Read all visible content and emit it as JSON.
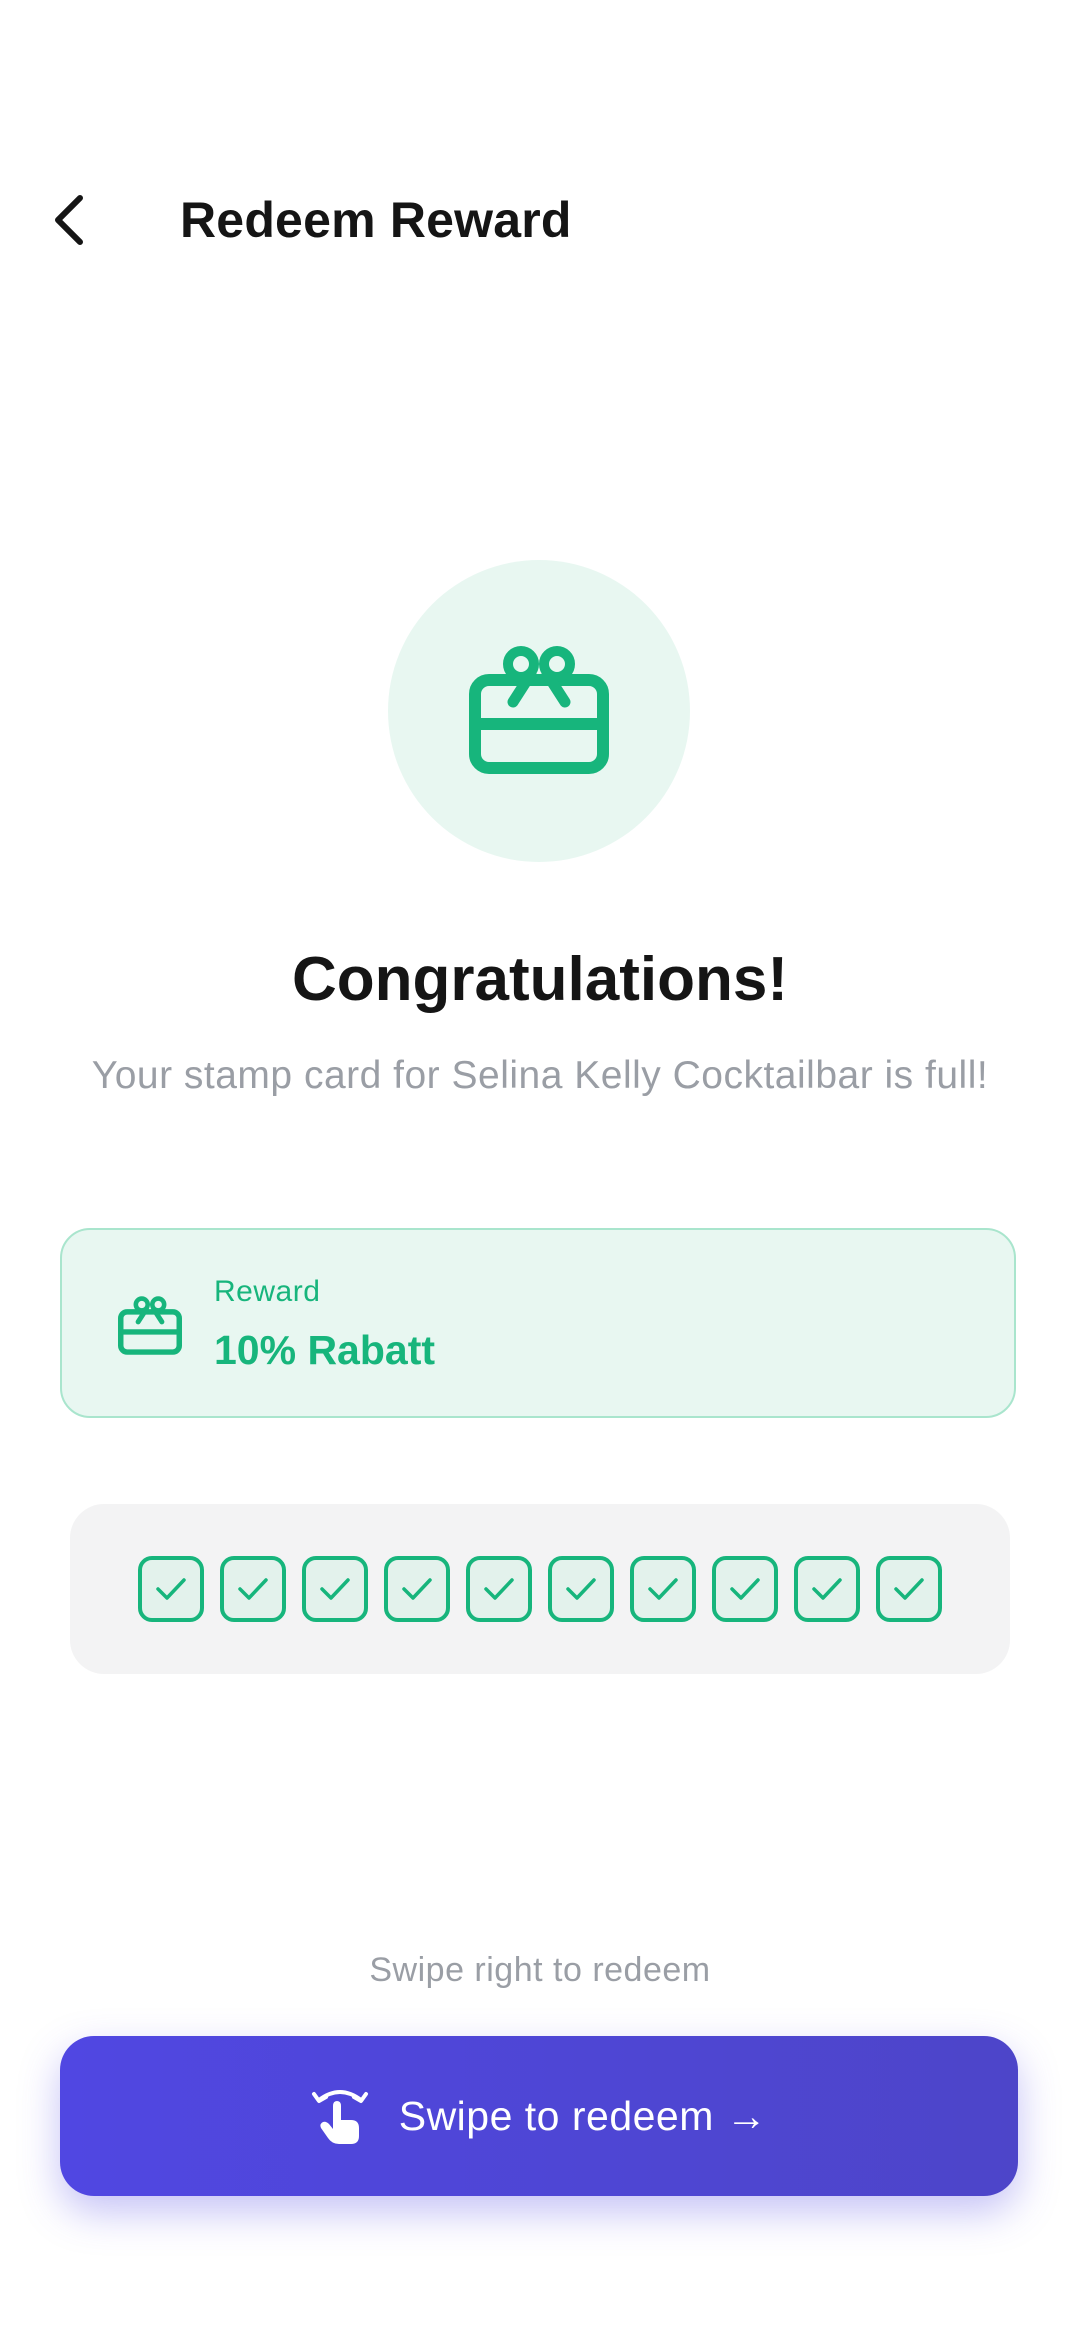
{
  "header": {
    "title": "Redeem Reward",
    "back_icon": "chevron-left-icon"
  },
  "hero": {
    "icon": "gift-card-icon",
    "heading": "Congratulations!",
    "message": "Your stamp card for Selina Kelly Cocktailbar is full!"
  },
  "reward": {
    "label": "Reward",
    "value": "10% Rabatt",
    "icon": "gift-card-icon"
  },
  "stamps": {
    "filled": 10,
    "total": 10,
    "icon": "check-icon"
  },
  "swipe": {
    "hint": "Swipe right to redeem",
    "button_label": "Swipe to redeem →",
    "icon": "swipe-gesture-icon"
  },
  "colors": {
    "accent_green": "#17b57c",
    "green_tint": "#e8f7f1",
    "button_purple": "#5047e2",
    "muted_text": "#9a9ea5"
  }
}
